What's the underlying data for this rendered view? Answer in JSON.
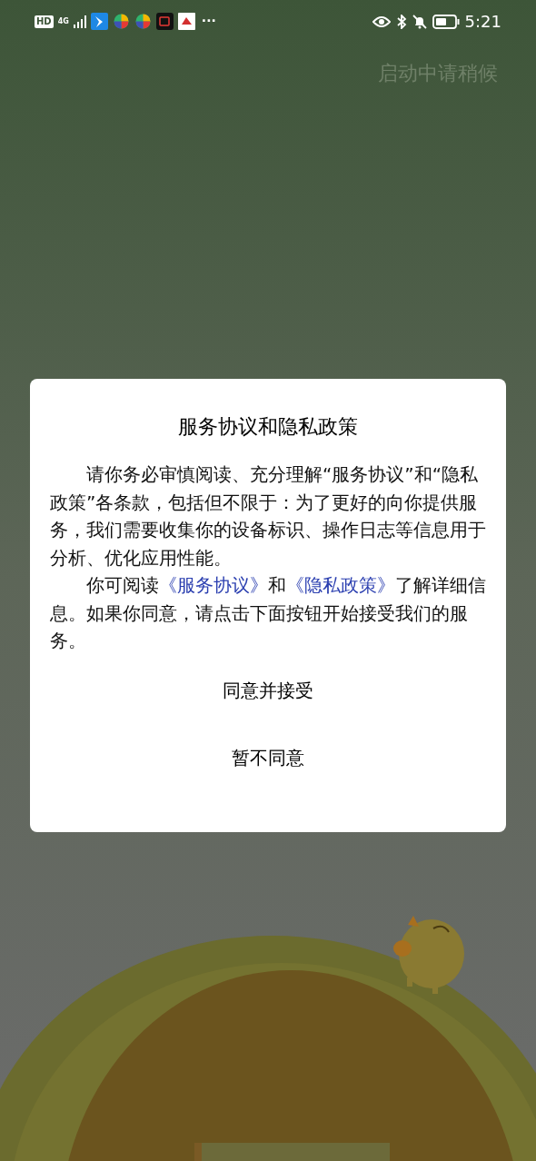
{
  "status_bar": {
    "hd_badge": "HD",
    "network": "4G",
    "more": "···",
    "time": "5:21"
  },
  "loading_text": "启动中请稍候",
  "dialog": {
    "title": "服务协议和隐私政策",
    "paragraphs": [
      {
        "parts": [
          {
            "kind": "text",
            "text": "请你务必审慎阅读、充分理解“服务协议”和“隐私政策”各条款，包括但不限于：为了更好的向你提供服务，我们需要收集你的设备标识、操作日志等信息用于分析、优化应用性能。"
          }
        ]
      },
      {
        "parts": [
          {
            "kind": "text",
            "text": "你可阅读"
          },
          {
            "kind": "link",
            "text": "《服务协议》"
          },
          {
            "kind": "text",
            "text": "和"
          },
          {
            "kind": "link",
            "text": "《隐私政策》"
          },
          {
            "kind": "text",
            "text": "了解详细信息。如果你同意，请点击下面按钮开始接受我们的服务。"
          }
        ]
      }
    ],
    "buttons": [
      "同意并接受",
      "暂不同意"
    ]
  }
}
